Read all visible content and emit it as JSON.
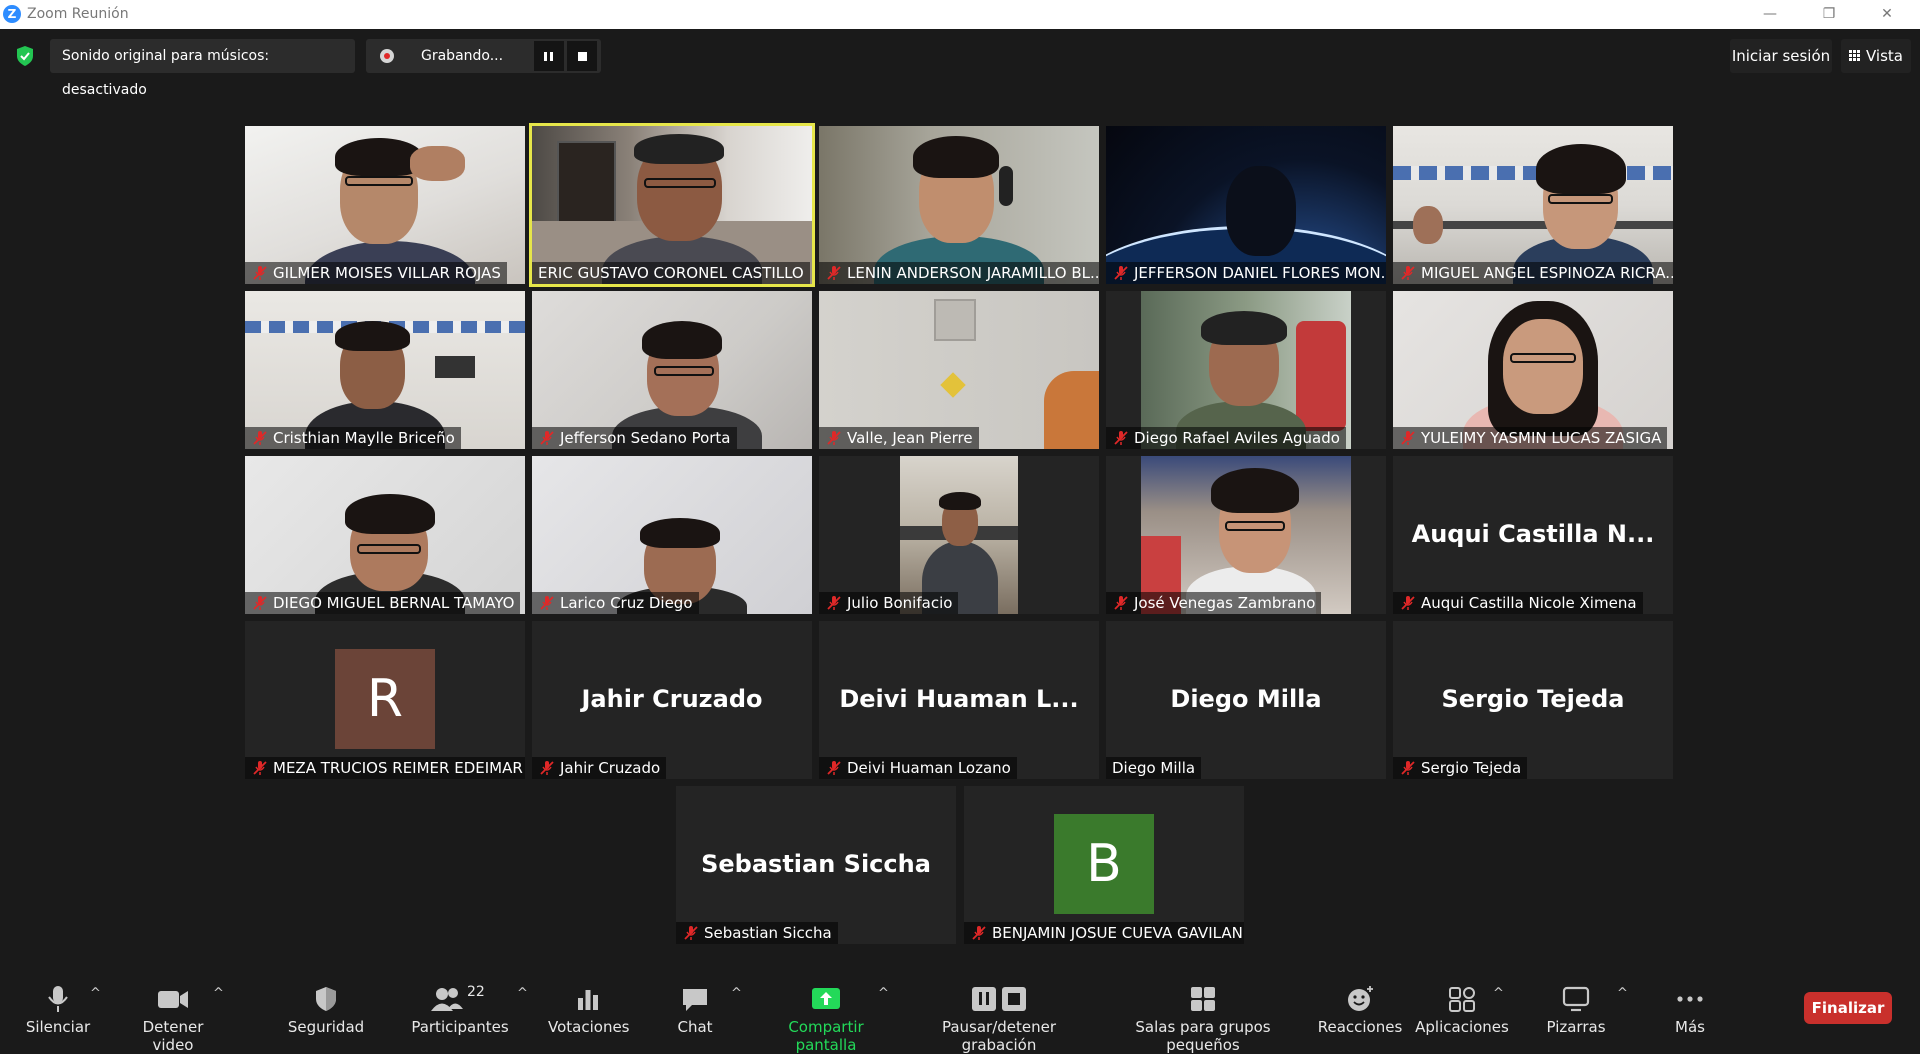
{
  "window": {
    "title": "Zoom Reunión",
    "logo_letter": "Z",
    "minimize_glyph": "—",
    "restore_glyph": "❐",
    "close_glyph": "✕"
  },
  "topbar": {
    "original_sound": "Sonido original para músicos: desactivado",
    "recording_label": "Grabando...",
    "sign_in": "Iniciar sesión",
    "view": "Vista"
  },
  "tiles": [
    {
      "name": "GILMER MOISES VILLAR ROJAS",
      "muted": true
    },
    {
      "name": "ERIC GUSTAVO CORONEL CASTILLO",
      "muted": false,
      "active_speaker": true
    },
    {
      "name": "LENIN ANDERSON JARAMILLO BL...",
      "muted": true
    },
    {
      "name": "JEFFERSON DANIEL FLORES MON...",
      "muted": true
    },
    {
      "name": "MIGUEL ANGEL ESPINOZA RICRA...",
      "muted": true
    },
    {
      "name": "Cristhian Maylle Briceño",
      "muted": true
    },
    {
      "name": "Jefferson Sedano Porta",
      "muted": true
    },
    {
      "name": "Valle, Jean Pierre",
      "muted": true
    },
    {
      "name": "Diego Rafael Aviles Aguado",
      "muted": true
    },
    {
      "name": "YULEIMY YASMIN LUCAS ZASIGA",
      "muted": true
    },
    {
      "name": "DIEGO MIGUEL BERNAL TAMAYO",
      "muted": true
    },
    {
      "name": "Larico Cruz Diego",
      "muted": true
    },
    {
      "name": "Julio Bonifacio",
      "muted": true
    },
    {
      "name": "José Venegas Zambrano",
      "muted": true
    },
    {
      "name": "Auqui Castilla Nicole Ximena",
      "muted": true,
      "display": "Auqui  Castilla  N..."
    },
    {
      "name": "MEZA TRUCIOS REIMER EDEIMAR",
      "muted": true,
      "avatar": "R",
      "avatar_color": "#6b4438"
    },
    {
      "name": "Jahir Cruzado",
      "muted": true,
      "display": "Jahir Cruzado"
    },
    {
      "name": "Deivi Huaman Lozano",
      "muted": true,
      "display": "Deivi  Huaman  L..."
    },
    {
      "name": "Diego Milla",
      "muted": false,
      "display": "Diego Milla"
    },
    {
      "name": "Sergio Tejeda",
      "muted": true,
      "display": "Sergio Tejeda"
    },
    {
      "name": "Sebastian Siccha",
      "muted": true,
      "display": "Sebastian Siccha"
    },
    {
      "name": "BENJAMIN JOSUE CUEVA GAVILAN",
      "muted": true,
      "avatar": "B",
      "avatar_color": "#3a7a2c"
    }
  ],
  "toolbar": {
    "mute": "Silenciar",
    "stop_video": "Detener video",
    "security": "Seguridad",
    "participants": "Participantes",
    "participants_count": "22",
    "polls": "Votaciones",
    "chat": "Chat",
    "share_screen": "Compartir pantalla",
    "pause_recording": "Pausar/detener grabación",
    "breakout_rooms": "Salas para grupos pequeños",
    "reactions": "Reacciones",
    "apps": "Aplicaciones",
    "whiteboards": "Pizarras",
    "more": "Más",
    "end": "Finalizar",
    "caret_glyph": "^"
  },
  "colors": {
    "background": "#1a1a1a",
    "tile": "#242424",
    "active_speaker_border": "#e6e64a",
    "mic_off": "#e02828",
    "share_green": "#23d959",
    "end_red": "#c9302c",
    "shield_green": "#23c552"
  }
}
